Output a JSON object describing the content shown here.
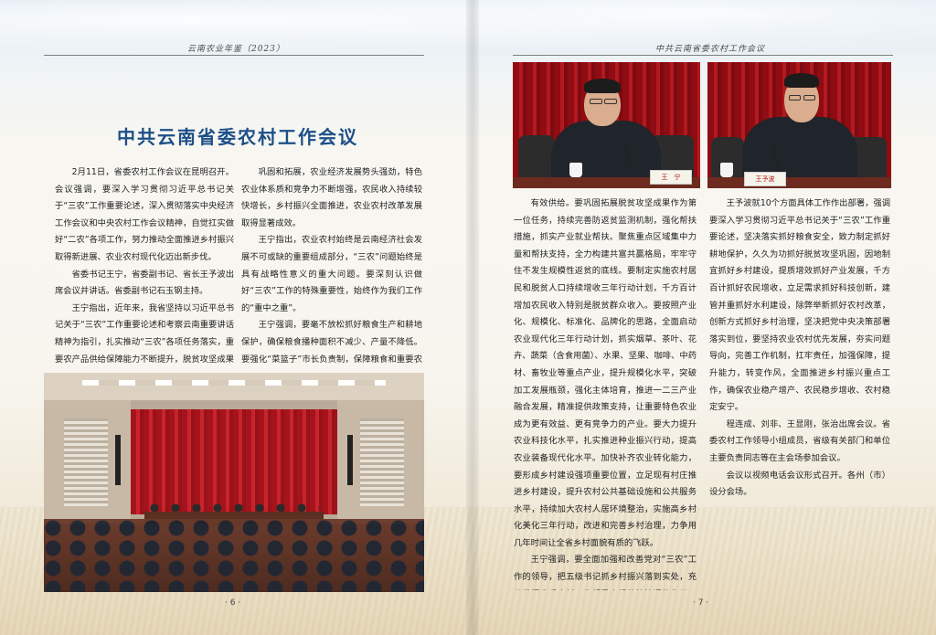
{
  "header": {
    "left_running_title": "云南农业年鉴（2023）",
    "right_running_title": "中共云南省委农村工作会议"
  },
  "article": {
    "title": "中共云南省委农村工作会议",
    "left_col1": [
      "2月11日，省委农村工作会议在昆明召开。会议强调，要深入学习贯彻习近平总书记关于“三农”工作重要论述，深入贯彻落实中央经济工作会议和中央农村工作会议精神，自觉扛实做好“二农”各项工作，努力推动全面推进乡村振兴取得新进展、农业农村现代化迈出新步伐。",
      "省委书记王宁，省委副书记、省长王予波出席会议并讲话。省委副书记石玉钢主持。",
      "王宁指出，近年来，我省坚持以习近平总书记关于“三农”工作重要论述和考察云南重要讲话精神为指引，扎实推动“三农”各项任务落实，重要农产品供给保障能力不断提升，脱贫攻坚成果得到"
    ],
    "left_col2": [
      "巩固和拓展，农业经济发展势头强劲，特色农业体系质和竞争力不断增强，农民收入持续较快增长，乡村振兴全面推进，农业农村改革发展取得显著成效。",
      "王宁指出，农业农村始终是云南经济社会发展不可或缺的重要组成部分，“三农”问题始终是具有战略性意义的重大问题。要深刻认识做好“三农”工作的特殊重要性，始终作为我们工作的“重中之重”。",
      "王宁强调，要毫不放松抓好粮食生产和耕地保护，确保粮食播种面积不减少、产量不降低。要强化“菜篮子”市长负责制，保障粮食和重要农产品"
    ],
    "right_col1": [
      "有效供给。要巩固拓展脱贫攻坚成果作为第一位任务，持续完善防返贫监测机制，强化帮扶措施，抓实产业就业帮扶。聚焦重点区域集中力量和帮扶支持，全力构建共富共赢格局，牢牢守住不发生规模性返贫的底线。要制定实施农村居民和脱贫人口持续增收三年行动计划，千方百计增加农民收入特别是脱贫群众收入。要按照产业化、规模化、标准化、品牌化的思路，全面启动农业现代化三年行动计划，抓实烟草、茶叶、花卉、蔬菜（含食用菌）、水果、坚果、咖啡、中药材、畜牧业等重点产业，提升规模化水平，突破加工发展瓶颈，强化主体培育，推进一二三产业融合发展，精准提供政策支持，让重要特色农业成为更有效益、更有竞争力的产业。要大力提升农业科技化水平，扎实推进种业振兴行动，提高农业装备现代化水平。加快补齐农业转化能力，要形成乡村建设强项重要位置，立足现有村庄推进乡村建设，提升农村公共基础设施和公共服务水平，持续加大农村人居环境整治，实施高乡村化美化三年行动，改进和完善乡村治理，力争用几年时间让全省乡村面貌有质的飞跃。",
      "王宁强调，要全面加强和改善党对“三农”工作的领导，把五级书记抓乡村振兴落到实处，充分发挥省委农村工作领导小组统筹协调的作用，要建一支懂农业、爱农村、爱农民的农村工作队伍，不断提高做好“三农”工作的能力和水平。"
    ],
    "right_col2": [
      "王予波就10个方面具体工作作出部署，强调要深入学习贯彻习近平总书记关于“三农”工作重要论述，坚决落实抓好粮食安全，致力制定抓好耕地保护，久久为功抓好脱贫攻坚巩固，因地制宜抓好乡村建设，提质增效抓好产业发展，千方百计抓好农民增收，立足需求抓好科技创新，建管并重抓好水利建设，除弊举新抓好农村改革，创新方式抓好乡村治理，坚决把党中央决策部署落实到位，要坚持农业农村优先发展，夯实问题导向，完善工作机制，扛牢责任，加强保障，提升能力，转变作风，全面推进乡村振兴重点工作，确保农业稳产增产、农民稳步增收、农村稳定安宁。",
      "程连成、刘非、王显刚，张治出席会议。省委农村工作领导小组成员，省级有关部门和单位主要负责同志等在主会场参加会议。",
      "会议以视频电话会议形式召开。各州（市）设分会场。"
    ],
    "signature": "（文/杨超　左毅　图/周灿）"
  },
  "photos": {
    "nameplate_left": "王　宁",
    "nameplate_right": "王予波"
  },
  "footer": {
    "left_page": "· 6 ·",
    "right_page": "· 7 ·"
  }
}
